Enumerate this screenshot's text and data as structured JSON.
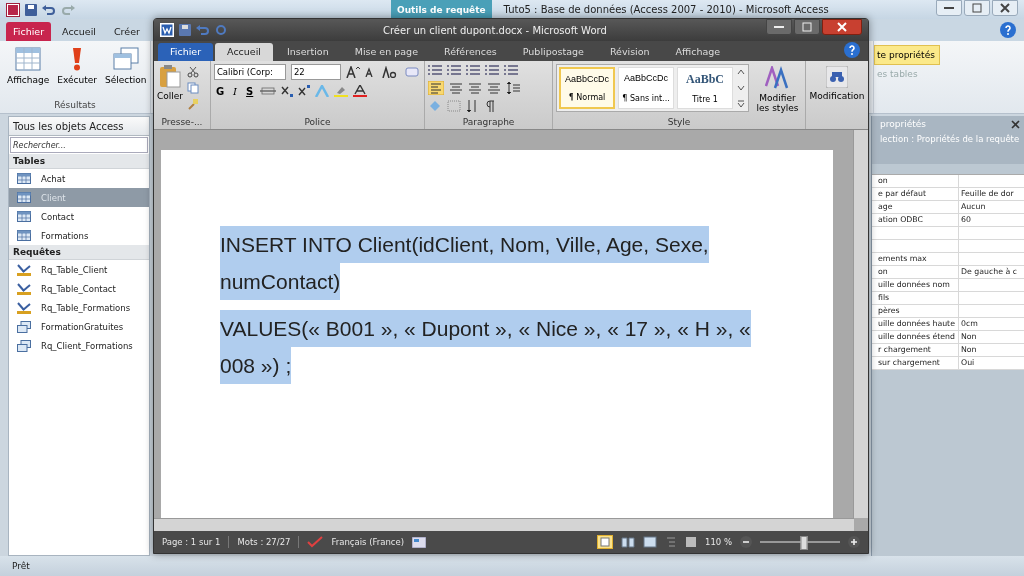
{
  "access": {
    "context_tab": "Outils de requête",
    "title": "Tuto5 : Base de données (Access 2007 - 2010)  -  Microsoft Access",
    "tabs": [
      {
        "label": "Fichier",
        "kind": "file",
        "selected": false
      },
      {
        "label": "Accueil",
        "kind": "tab",
        "selected": false
      },
      {
        "label": "Créer",
        "kind": "tab",
        "selected": false
      }
    ],
    "ribbon_buttons": [
      {
        "label": "Affichage",
        "kind": "grid"
      },
      {
        "label": "Exécuter",
        "kind": "run"
      },
      {
        "label": "Sélection",
        "kind": "select"
      }
    ],
    "ribbon_group": "Résultats",
    "right_button": "te propriétés",
    "right_hint": "es tables",
    "nav": {
      "header": "Tous les objets Access",
      "search_placeholder": "Rechercher...",
      "groups": [
        {
          "label": "Tables",
          "items": [
            {
              "label": "Achat",
              "kind": "table",
              "selected": false
            },
            {
              "label": "Client",
              "kind": "table",
              "selected": true
            },
            {
              "label": "Contact",
              "kind": "table",
              "selected": false
            },
            {
              "label": "Formations",
              "kind": "table",
              "selected": false
            }
          ]
        },
        {
          "label": "Requêtes",
          "items": [
            {
              "label": "Rq_Table_Client",
              "kind": "update",
              "selected": false
            },
            {
              "label": "Rq_Table_Contact",
              "kind": "update",
              "selected": false
            },
            {
              "label": "Rq_Table_Formations",
              "kind": "update",
              "selected": false
            },
            {
              "label": "FormationGratuites",
              "kind": "select",
              "selected": false
            },
            {
              "label": "Rq_Client_Formations",
              "kind": "select",
              "selected": false
            }
          ]
        }
      ]
    },
    "properties": {
      "title": "propriétés",
      "subtitle": "lection :  Propriétés de la requête",
      "rows": [
        {
          "name": "on",
          "value": ""
        },
        {
          "name": "e par défaut",
          "value": "Feuille de dor"
        },
        {
          "name": "age",
          "value": "Aucun"
        },
        {
          "name": "ation ODBC",
          "value": "60"
        },
        {
          "name": "",
          "value": ""
        },
        {
          "name": "",
          "value": ""
        },
        {
          "name": "ements max",
          "value": ""
        },
        {
          "name": "on",
          "value": "De gauche à c"
        },
        {
          "name": "uille données nom",
          "value": ""
        },
        {
          "name": "fils",
          "value": ""
        },
        {
          "name": "pères",
          "value": ""
        },
        {
          "name": "uille données haute",
          "value": "0cm"
        },
        {
          "name": "uille données étend",
          "value": "Non"
        },
        {
          "name": "r chargement",
          "value": "Non"
        },
        {
          "name": "sur chargement",
          "value": "Oui"
        }
      ]
    },
    "status": "Prêt"
  },
  "word": {
    "title": "Créer un client dupont.docx  -  Microsoft Word",
    "tabs": [
      {
        "label": "Fichier",
        "kind": "file",
        "selected": false
      },
      {
        "label": "Accueil",
        "kind": "tab",
        "selected": true
      },
      {
        "label": "Insertion",
        "kind": "tab",
        "selected": false
      },
      {
        "label": "Mise en page",
        "kind": "tab",
        "selected": false
      },
      {
        "label": "Références",
        "kind": "tab",
        "selected": false
      },
      {
        "label": "Publipostage",
        "kind": "tab",
        "selected": false
      },
      {
        "label": "Révision",
        "kind": "tab",
        "selected": false
      },
      {
        "label": "Affichage",
        "kind": "tab",
        "selected": false
      }
    ],
    "paste_label": "Coller",
    "font_name": "Calibri (Corp:",
    "font_size": "22",
    "format_buttons": [
      "G",
      "I",
      "S"
    ],
    "groups": [
      "Presse-...",
      "Police",
      "Paragraphe",
      "Style"
    ],
    "styles": [
      {
        "sample": "AaBbCcDc",
        "label": "¶ Normal",
        "kind": "normal",
        "selected": true
      },
      {
        "sample": "AaBbCcDc",
        "label": "¶ Sans int...",
        "kind": "normal",
        "selected": false
      },
      {
        "sample": "AaBbC",
        "label": "Titre 1",
        "kind": "heading",
        "selected": false
      }
    ],
    "modify_styles": "Modifier les styles",
    "editing": "Modification",
    "paragraphs": [
      "INSERT INTO Client(idClient, Nom, Ville, Age, Sexe, numContact)",
      "VALUES(« B001 », « Dupont », « Nice », « 17 », « H », « 008 ») ;"
    ],
    "status": {
      "page": "Page : 1 sur 1",
      "words": "Mots : 27/27",
      "language": "Français (France)",
      "zoom": "110 %",
      "zoom_level": {
        "level": 0.55
      }
    }
  }
}
